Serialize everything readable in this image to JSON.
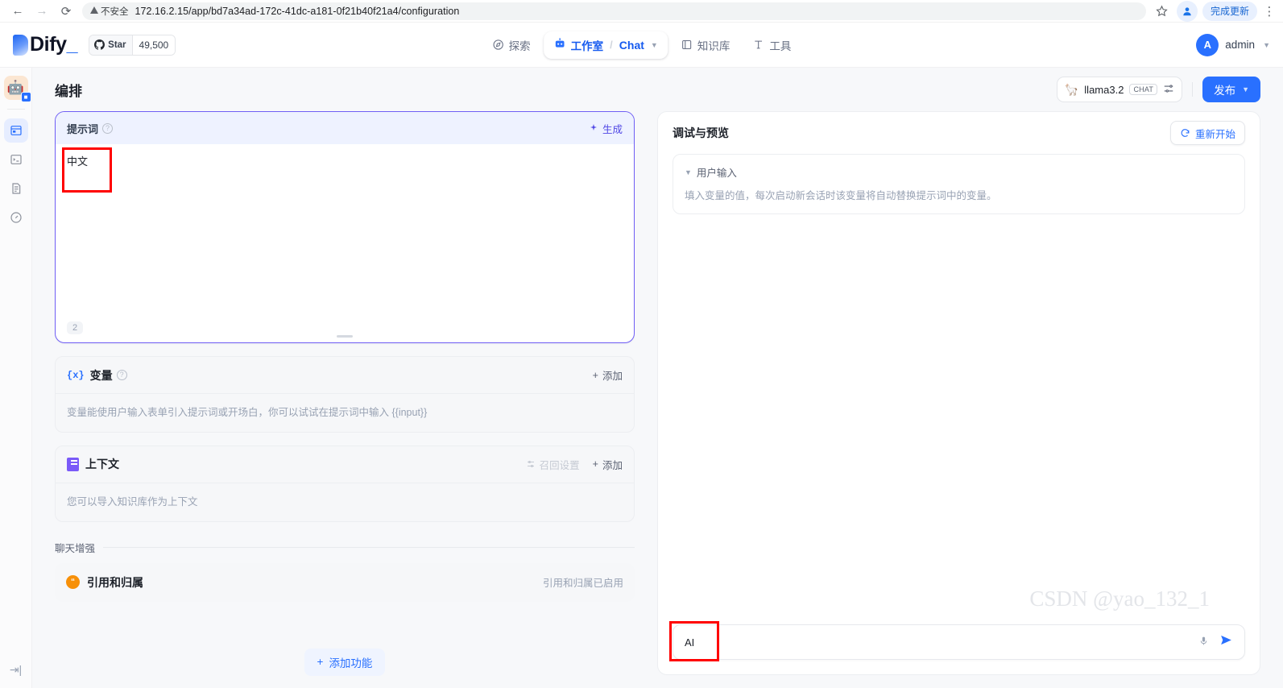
{
  "browser": {
    "back_icon": "back-arrow-icon",
    "forward_icon": "forward-arrow-icon",
    "reload_icon": "reload-icon",
    "security_label": "不安全",
    "url": "172.16.2.15/app/bd7a34ad-172c-41dc-a181-0f21b40f21a4/configuration",
    "bookmark_icon": "star-icon",
    "profile_icon": "profile-icon",
    "update_label": "完成更新",
    "menu_icon": "kebab-menu-icon"
  },
  "header": {
    "logo_text": "Dify",
    "logo_dot": "_",
    "star_label": "Star",
    "star_count": "49,500",
    "nav": [
      {
        "label": "探索",
        "icon": "compass-icon"
      },
      {
        "label": "工作室",
        "icon": "robot-icon"
      },
      {
        "label": "知识库",
        "icon": "book-icon"
      },
      {
        "label": "工具",
        "icon": "tool-icon"
      }
    ],
    "breadcrumb_sep": "/",
    "breadcrumb_current": "Chat",
    "user": {
      "initial": "A",
      "name": "admin"
    }
  },
  "rail": {
    "app_avatar_icon": "robot-avatar-icon",
    "items": [
      {
        "icon": "orchestrate-icon",
        "name": "orchestrate"
      },
      {
        "icon": "api-terminal-icon",
        "name": "api-access"
      },
      {
        "icon": "logs-icon",
        "name": "logs"
      },
      {
        "icon": "monitoring-gauge-icon",
        "name": "monitoring"
      }
    ],
    "collapse_icon": "collapse-sidebar-icon"
  },
  "main": {
    "page_title": "编排",
    "model": {
      "name": "llama3.2",
      "tag": "CHAT",
      "icon": "llama-icon",
      "settings_icon": "sliders-icon"
    },
    "publish_label": "发布"
  },
  "prompt": {
    "title": "提示词",
    "info_icon": "info-icon",
    "generate_label": "生成",
    "generate_icon": "sparkle-icon",
    "content": "中文",
    "char_count": "2",
    "resize_handle": "resize-grip"
  },
  "variables": {
    "icon": "{x}",
    "title": "变量",
    "info_icon": "info-icon",
    "add_label": "添加",
    "description": "变量能使用户输入表单引入提示词或开场白，你可以试试在提示词中输入 {{input}}"
  },
  "context": {
    "icon": "document-icon",
    "title": "上下文",
    "recall_label": "召回设置",
    "recall_icon": "settings-sliders-icon",
    "add_label": "添加",
    "description": "您可以导入知识库作为上下文"
  },
  "chat_enhance": {
    "section_label": "聊天增强",
    "feature_icon": "quote-icon",
    "feature_title": "引用和归属",
    "feature_status": "引用和归属已启用",
    "add_feature_label": "添加功能"
  },
  "preview": {
    "title": "调试与预览",
    "restart_label": "重新开始",
    "restart_icon": "refresh-icon",
    "user_input_title": "用户输入",
    "user_input_desc": "填入变量的值，每次启动新会话时该变量将自动替换提示词中的变量。",
    "watermark": "CSDN @yao_132_1",
    "composer_value": "AI",
    "send_icon": "send-icon",
    "mic_icon": "microphone-icon"
  },
  "colors": {
    "brand_blue": "#2970ff",
    "prompt_border": "#6f5ef5",
    "highlight_red": "#ff0000",
    "feature_orange": "#f79009"
  }
}
